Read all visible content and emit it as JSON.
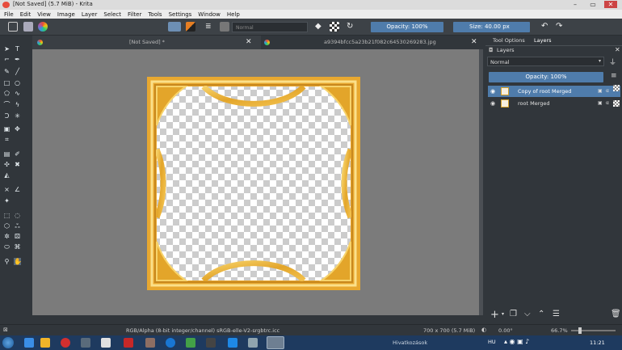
{
  "window": {
    "title": "[Not Saved]  (5.7 MiB) - Krita"
  },
  "menu": [
    "File",
    "Edit",
    "View",
    "Image",
    "Layer",
    "Select",
    "Filter",
    "Tools",
    "Settings",
    "Window",
    "Help"
  ],
  "toolbar": {
    "blend_mode": "Normal",
    "opacity": "Opacity: 100%",
    "size": "Size: 40.00 px"
  },
  "tabs": {
    "doc1": "[Not Saved]  *",
    "doc2": "a9394bfcc5a23b21f082c64530269283.jpg"
  },
  "dock": {
    "tabs": [
      "Tool Options",
      "Layers"
    ],
    "layers_title": "Layers",
    "blend_mode": "Normal",
    "opacity": "Opacity:  100%",
    "layers": [
      {
        "name": "Copy of root Merged",
        "selected": true
      },
      {
        "name": "root Merged",
        "selected": false
      }
    ]
  },
  "status": {
    "color_info": "RGB/Alpha (8-bit integer/channel)  sRGB-elle-V2-srgbtrc.icc",
    "size_info": "700 x 700 (5.7 MiB)",
    "rotation": "0.00°",
    "zoom": "66.7%"
  },
  "taskbar": {
    "language": "HU",
    "tray_text": "Hivatkozások",
    "clock": "11:21"
  },
  "colors": {
    "accent": "#4f7cab",
    "frame_gold": "#e8b030",
    "canvas_bg": "#7b7b7b"
  }
}
